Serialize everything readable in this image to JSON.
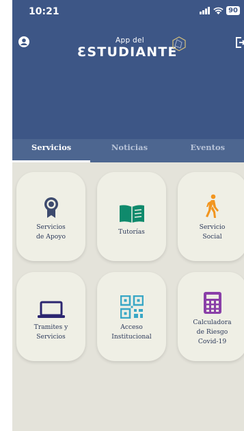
{
  "status_bar": {
    "time": "10:21",
    "battery": "90"
  },
  "header": {
    "logo_small": "App del",
    "logo_big": "ƐSTUDIANTE"
  },
  "tabs": [
    {
      "label": "Servicios",
      "active": true
    },
    {
      "label": "Noticias",
      "active": false
    },
    {
      "label": "Eventos",
      "active": false
    }
  ],
  "tiles": [
    {
      "label": "Servicios\nde Apoyo",
      "icon": "award-ribbon-icon",
      "color": "#3d4a6e"
    },
    {
      "label": "Tutorías",
      "icon": "open-book-icon",
      "color": "#0f8a6c"
    },
    {
      "label": "Servicio\nSocial",
      "icon": "walking-person-icon",
      "color": "#f2951f"
    },
    {
      "label": "Tramites y\nServicios",
      "icon": "laptop-icon",
      "color": "#2b2570"
    },
    {
      "label": "Acceso\nInstitucional",
      "icon": "qr-code-icon",
      "color": "#3aa7c6"
    },
    {
      "label": "Calculadora\nde Riesgo\nCovid-19",
      "icon": "calculator-icon",
      "color": "#8a3fa8"
    }
  ]
}
